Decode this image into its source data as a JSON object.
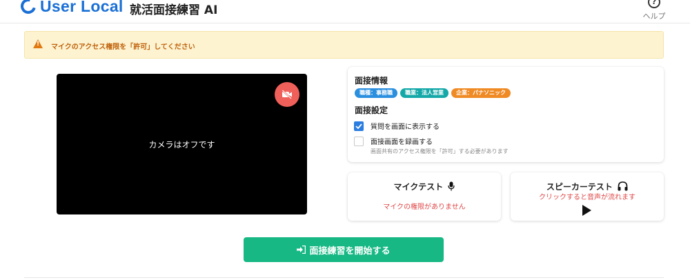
{
  "header": {
    "logo_text": "User Local",
    "app_title": "就活面接練習 AI",
    "help_icon_glyph": "?",
    "help_label": "ヘルプ",
    "brand_color": "#1a6fd6"
  },
  "alert": {
    "icon": "warning-icon",
    "message": "マイクのアクセス権限を「許可」してください",
    "color": "#c0620c",
    "background": "#fdf3d0"
  },
  "camera": {
    "status_text": "カメラはオフです",
    "toggle_icon": "camera-off-icon",
    "toggle_color": "#f0605a"
  },
  "settings": {
    "info_title": "面接情報",
    "badges": [
      {
        "label": "職種：事務職",
        "color": "#2b8fe0"
      },
      {
        "label": "職業：法人営業",
        "color": "#15a8a8"
      },
      {
        "label": "企業：パナソニック",
        "color": "#ef8a24"
      }
    ],
    "settings_title": "面接設定",
    "options": [
      {
        "label": "質問を画面に表示する",
        "checked": true
      },
      {
        "label": "面接画面を録画する",
        "checked": false
      }
    ],
    "record_hint": "画面共有のアクセス権限を「許可」する必要があります"
  },
  "mic_test": {
    "title": "マイクテスト",
    "icon": "microphone-icon",
    "status": "マイクの権限がありません"
  },
  "speaker_test": {
    "title": "スピーカーテスト",
    "icon": "headphones-icon",
    "status": "クリックすると音声が流れます",
    "play_icon": "play-icon"
  },
  "start_button": {
    "label": "面接練習を開始する",
    "icon": "sign-in-icon",
    "color": "#17b884"
  }
}
